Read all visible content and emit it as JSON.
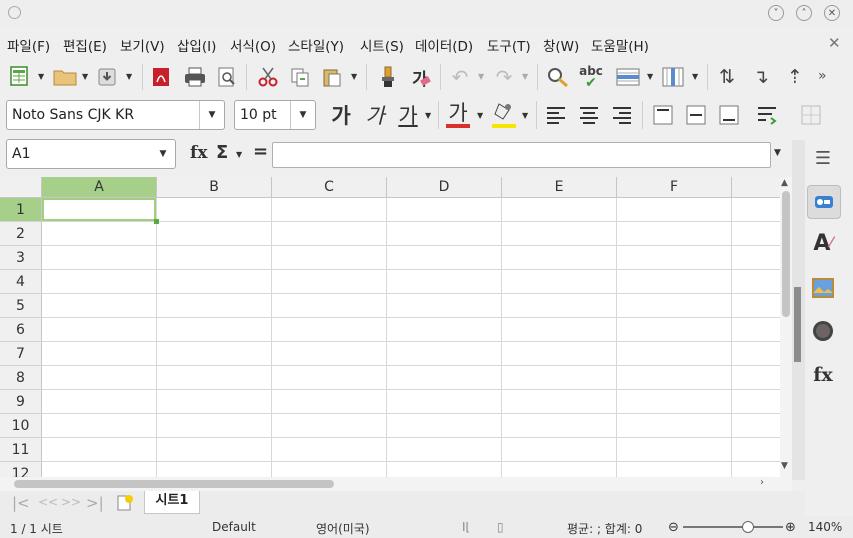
{
  "menu": [
    "파일(F)",
    "편집(E)",
    "보기(V)",
    "삽입(I)",
    "서식(O)",
    "스타일(Y)",
    "시트(S)",
    "데이터(D)",
    "도구(T)",
    "창(W)",
    "도움말(H)"
  ],
  "window_buttons": [
    "˅",
    "˄",
    "✕"
  ],
  "close_doc": "✕",
  "font_name": "Noto Sans CJK KR",
  "font_size": "10 pt",
  "bold_glyph": "가",
  "italic_glyph": "가",
  "underline_glyph": "가",
  "font_color_glyph": "가",
  "spell_label": "abc",
  "cell_ref": "A1",
  "fx_label": "fx",
  "sum_label": "Σ",
  "equals_label": "=",
  "columns": [
    "A",
    "B",
    "C",
    "D",
    "E",
    "F"
  ],
  "rows": [
    "1",
    "2",
    "3",
    "4",
    "5",
    "6",
    "7",
    "8",
    "9",
    "10",
    "11",
    "12"
  ],
  "sheet_tab": "시트1",
  "status": {
    "sheet_count": "1 / 1 시트",
    "page_style": "Default",
    "language": "영어(미국)",
    "summary": "평균: ; 합계: 0",
    "zoom": "140%",
    "zoom_level": 0.64
  },
  "colors": {
    "accent_green": "#9fcf7f",
    "selected_header": "#a6cf8a",
    "font_color_bar": "#d9302c",
    "highlight_bar": "#f5e500"
  }
}
